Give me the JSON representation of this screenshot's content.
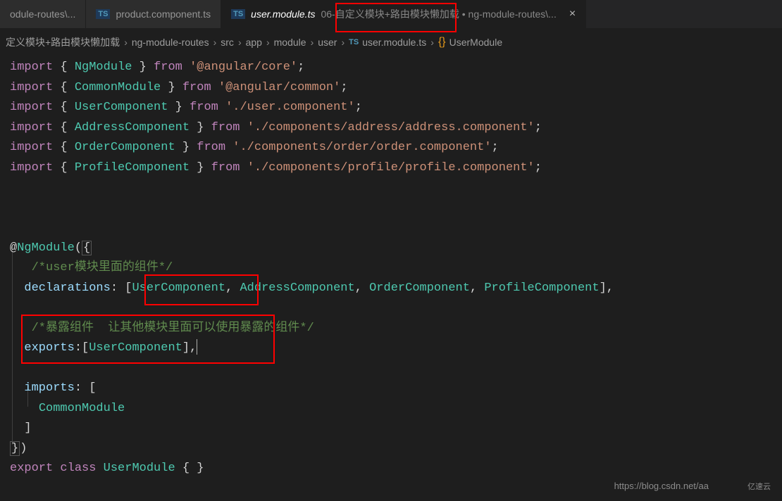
{
  "tabs": [
    {
      "label": "odule-routes\\...",
      "icon": ""
    },
    {
      "label": "product.component.ts",
      "icon": "TS"
    },
    {
      "label": "user.module.ts",
      "desc": "06-自定义模块+路由模块懒加载 • ng-module-routes\\...",
      "icon": "TS",
      "active": true
    }
  ],
  "breadcrumb": {
    "parts": [
      "定义模块+路由模块懒加载",
      "ng-module-routes",
      "src",
      "app",
      "module",
      "user",
      "user.module.ts",
      "UserModule"
    ],
    "tsBadge": "TS",
    "sym": "{}"
  },
  "code": {
    "l1": {
      "kw1": "import",
      "b1": "{",
      "id": "NgModule",
      "b2": "}",
      "kw2": "from",
      "str": "'@angular/core'",
      "end": ";"
    },
    "l2": {
      "kw1": "import",
      "b1": "{",
      "id": "CommonModule",
      "b2": "}",
      "kw2": "from",
      "str": "'@angular/common'",
      "end": ";"
    },
    "l3": {
      "kw1": "import",
      "b1": "{",
      "id": "UserComponent",
      "b2": "}",
      "kw2": "from",
      "str": "'./user.component'",
      "end": ";"
    },
    "l4": {
      "kw1": "import",
      "b1": "{",
      "id": "AddressComponent",
      "b2": "}",
      "kw2": "from",
      "str": "'./components/address/address.component'",
      "end": ";"
    },
    "l5": {
      "kw1": "import",
      "b1": "{",
      "id": "OrderComponent",
      "b2": "}",
      "kw2": "from",
      "str": "'./components/order/order.component'",
      "end": ";"
    },
    "l6": {
      "kw1": "import",
      "b1": "{",
      "id": "ProfileComponent",
      "b2": "}",
      "kw2": "from",
      "str": "'./components/profile/profile.component'",
      "end": ";"
    },
    "dec": {
      "at": "@",
      "name": "NgModule",
      "open": "(",
      "brace": "{"
    },
    "c1": "/*user模块里面的组件*/",
    "decl": {
      "prop": "declarations",
      "colon": ":",
      "open": "[",
      "id1": "UserComponent",
      "id2": "AddressComponent",
      "id3": "OrderComponent",
      "id4": "ProfileComponent",
      "close": "]",
      "end": ","
    },
    "c2": "/*暴露组件  让其他模块里面可以使用暴露的组件*/",
    "exp": {
      "prop": "exports",
      "colon": ":",
      "open": "[",
      "id1": "UserComponent",
      "close": "]",
      "end": ","
    },
    "imp": {
      "prop": "imports",
      "colon": ":",
      "open": "["
    },
    "impItem": "CommonModule",
    "impClose": "]",
    "closeDec": {
      "brace": "}",
      "paren": ")"
    },
    "cls": {
      "kw1": "export",
      "kw2": "class",
      "name": "UserModule",
      "open": "{",
      "close": "}"
    }
  },
  "watermark": "https://blog.csdn.net/aa",
  "watermark2": "亿速云"
}
